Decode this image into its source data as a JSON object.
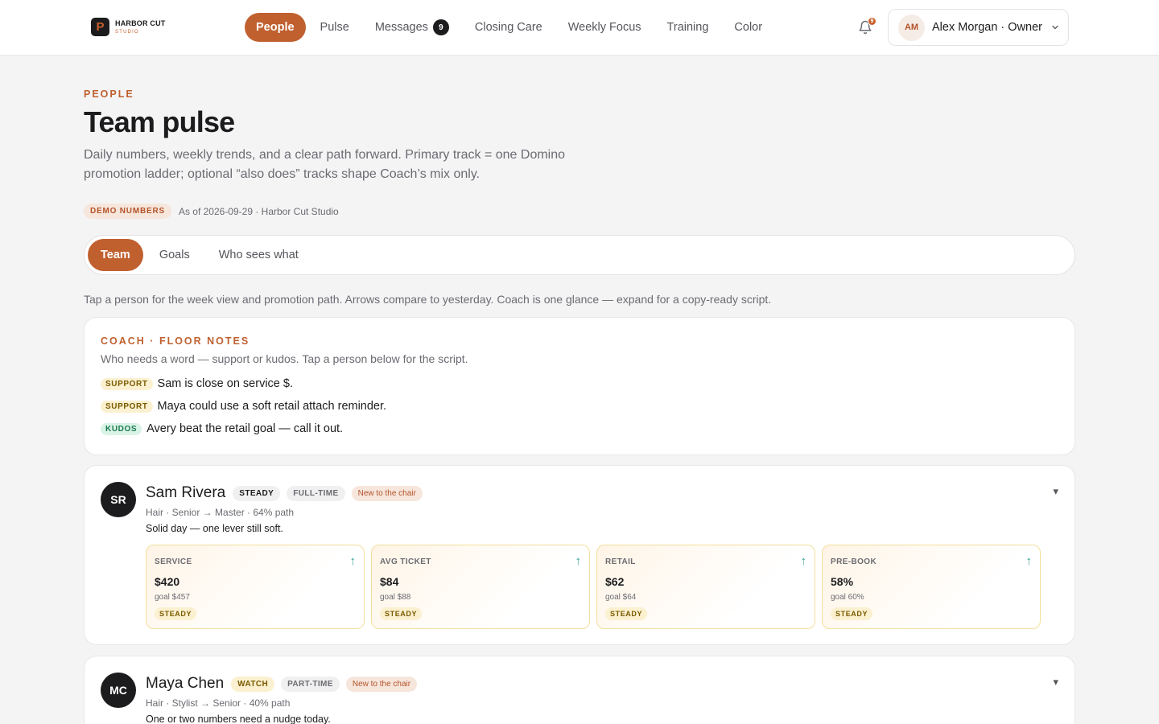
{
  "brand": {
    "mark": "P",
    "name": "HARBOR CUT",
    "sub": "STUDIO"
  },
  "nav": {
    "items": [
      {
        "label": "People",
        "active": true
      },
      {
        "label": "Pulse"
      },
      {
        "label": "Messages",
        "badge": "9"
      },
      {
        "label": "Closing Care"
      },
      {
        "label": "Weekly Focus"
      },
      {
        "label": "Training"
      },
      {
        "label": "Color"
      }
    ]
  },
  "notifications": {
    "icon": "bell-icon",
    "count": "9"
  },
  "user": {
    "initials": "AM",
    "label": "Alex Morgan · Owner",
    "icon": "chevron-down-icon"
  },
  "header": {
    "eyebrow": "PEOPLE",
    "title": "Team pulse",
    "description": "Daily numbers, weekly trends, and a clear path forward. Primary track = one Domino promotion ladder; optional “also does” tracks shape Coach’s mix only.",
    "demo_pill": "DEMO NUMBERS",
    "meta": "As of 2026-09-29 · Harbor Cut Studio"
  },
  "tabs": [
    {
      "label": "Team",
      "active": true
    },
    {
      "label": "Goals"
    },
    {
      "label": "Who sees what"
    }
  ],
  "hint": "Tap a person for the week view and promotion path. Arrows compare to yesterday. Coach is one glance — expand for a copy-ready script.",
  "coach": {
    "eyebrow": "COACH · FLOOR NOTES",
    "subtitle": "Who needs a word — support or kudos. Tap a person below for the script.",
    "notes": [
      {
        "tag": "SUPPORT",
        "text": "Sam is close on service $."
      },
      {
        "tag": "SUPPORT",
        "text": "Maya could use a soft retail attach reminder."
      },
      {
        "tag": "KUDOS",
        "text": "Avery beat the retail goal — call it out."
      }
    ]
  },
  "people": [
    {
      "initials": "SR",
      "name": "Sam Rivera",
      "status": "STEADY",
      "employment": "FULL-TIME",
      "flag": "New to the chair",
      "track": "Hair · Senior → Master · 64% path",
      "summary": "Solid day — one lever still soft.",
      "toggle": "▾",
      "metrics": [
        {
          "label": "SERVICE",
          "value": "$420",
          "goal": "goal $457",
          "status": "STEADY",
          "arrow": "↑"
        },
        {
          "label": "AVG TICKET",
          "value": "$84",
          "goal": "goal $88",
          "status": "STEADY",
          "arrow": "↑"
        },
        {
          "label": "RETAIL",
          "value": "$62",
          "goal": "goal $64",
          "status": "STEADY",
          "arrow": "↑"
        },
        {
          "label": "PRE-BOOK",
          "value": "58%",
          "goal": "goal 60%",
          "status": "STEADY",
          "arrow": "↑"
        }
      ]
    },
    {
      "initials": "MC",
      "name": "Maya Chen",
      "status": "WATCH",
      "employment": "PART-TIME",
      "flag": "New to the chair",
      "track": "Hair · Stylist → Senior · 40% path",
      "summary": "One or two numbers need a nudge today.",
      "toggle": "▾"
    }
  ],
  "colors": {
    "accent": "#c0602f",
    "support": "#fbf0cf",
    "kudos": "#d9f3e6",
    "trend_up": "#2f9d8f"
  }
}
